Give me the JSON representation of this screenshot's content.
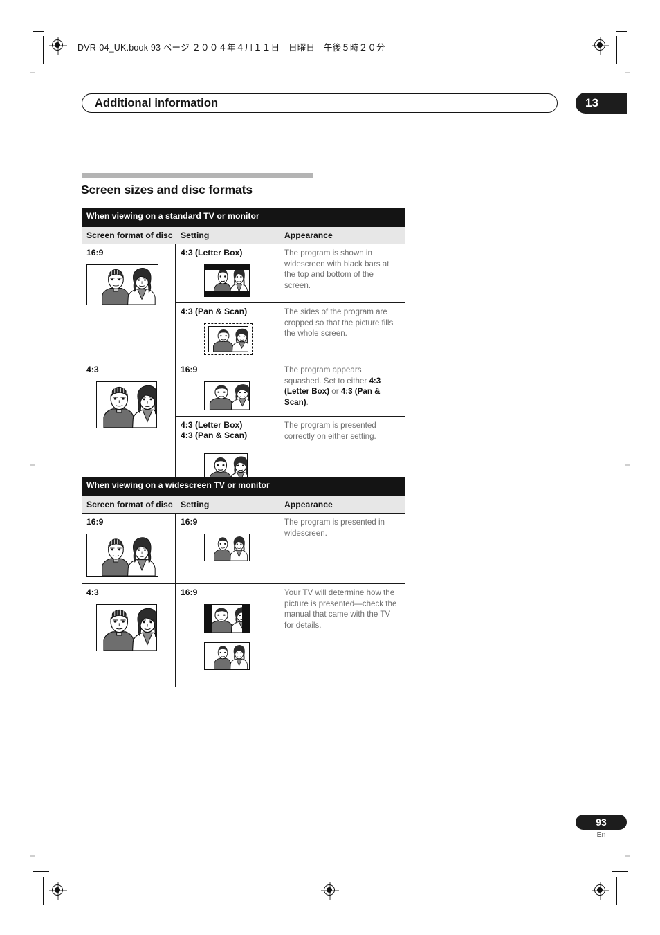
{
  "header": {
    "book_line": "DVR-04_UK.book  93 ページ  ２００４年４月１１日　日曜日　午後５時２０分",
    "chapter_title": "Additional information",
    "chapter_number": "13"
  },
  "section": {
    "title": "Screen sizes and disc formats"
  },
  "tables": [
    {
      "band_title": "When viewing on a standard TV or monitor",
      "columns": [
        "Screen format of disc",
        "Setting",
        "Appearance"
      ],
      "rows": [
        {
          "disc_format": "16:9",
          "settings": [
            {
              "setting": "4:3 (Letter Box)",
              "appearance": "The program is shown in widescreen with black bars at the top and bottom of the screen."
            },
            {
              "setting": "4:3 (Pan & Scan)",
              "appearance": "The sides of the program are cropped so that the picture fills the whole screen."
            }
          ]
        },
        {
          "disc_format": "4:3",
          "settings": [
            {
              "setting": "16:9",
              "appearance_parts": [
                {
                  "text": "The program appears squashed. Set to either ",
                  "bold": false
                },
                {
                  "text": "4:3 (Letter Box)",
                  "bold": true
                },
                {
                  "text": " or ",
                  "bold": false
                },
                {
                  "text": "4:3 (Pan & Scan)",
                  "bold": true
                },
                {
                  "text": ".",
                  "bold": false
                }
              ]
            },
            {
              "setting": "4:3 (Letter Box)",
              "setting_line2": "4:3 (Pan & Scan)",
              "appearance": "The program is presented correctly on either setting."
            }
          ]
        }
      ]
    },
    {
      "band_title": "When viewing on a widescreen TV or monitor",
      "columns": [
        "Screen format of disc",
        "Setting",
        "Appearance"
      ],
      "rows": [
        {
          "disc_format": "16:9",
          "settings": [
            {
              "setting": "16:9",
              "appearance": "The program is presented in widescreen."
            }
          ]
        },
        {
          "disc_format": "4:3",
          "settings": [
            {
              "setting": "16:9",
              "appearance": "Your TV will determine how the picture is presented—check the manual that came with the TV for details."
            }
          ]
        }
      ]
    }
  ],
  "footer": {
    "page_number": "93",
    "language": "En"
  },
  "colors": {
    "band_background": "#141414",
    "column_header_background": "#e7e7e7",
    "rule_bar": "#b4b4b4",
    "body_text": "#6f6f6f",
    "heading_text": "#141414"
  }
}
